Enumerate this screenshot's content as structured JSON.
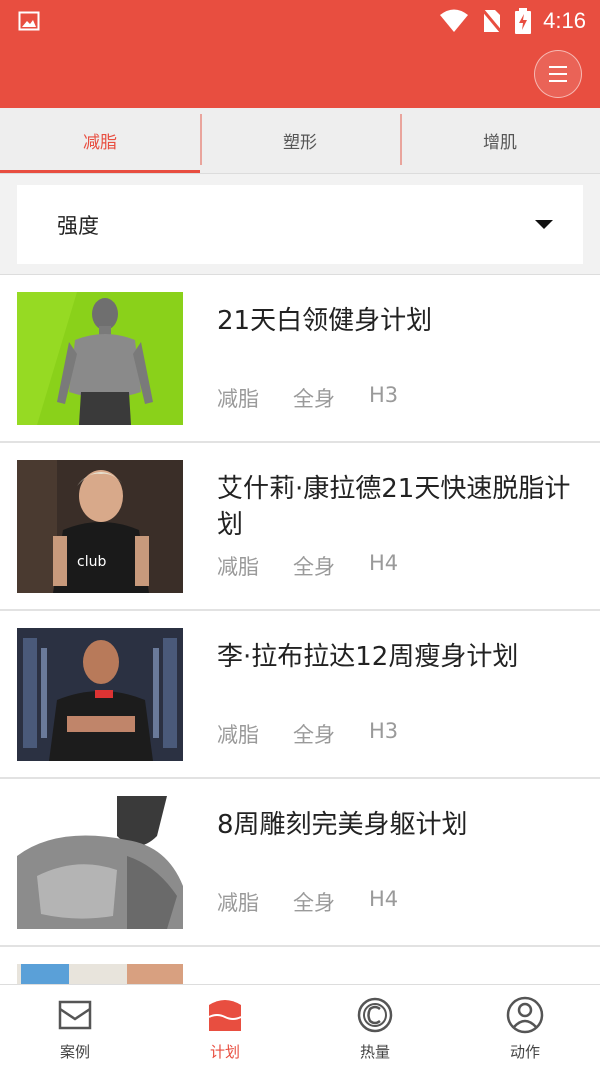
{
  "status_bar": {
    "time": "4:16",
    "icons": [
      "image-icon",
      "wifi-icon",
      "no-sim-icon",
      "battery-charging-icon"
    ]
  },
  "app_bar": {
    "menu_icon": "menu-icon"
  },
  "colors": {
    "primary": "#e84e40",
    "tag_text": "#9a9a9a",
    "background": "#f2f2f2"
  },
  "tabs": [
    {
      "label": "减脂",
      "active": true
    },
    {
      "label": "塑形",
      "active": false
    },
    {
      "label": "增肌",
      "active": false
    }
  ],
  "filter": {
    "label": "强度",
    "icon": "dropdown-caret-icon"
  },
  "plans": [
    {
      "title": "21天白领健身计划",
      "tags": [
        "减脂",
        "全身",
        "H3"
      ]
    },
    {
      "title": "艾什莉·康拉德21天快速脱脂计划",
      "tags": [
        "减脂",
        "全身",
        "H4"
      ]
    },
    {
      "title": "李·拉布拉达12周瘦身计划",
      "tags": [
        "减脂",
        "全身",
        "H3"
      ]
    },
    {
      "title": "8周雕刻完美身躯计划",
      "tags": [
        "减脂",
        "全身",
        "H4"
      ]
    },
    {
      "title": "",
      "tags": [
        "",
        "",
        ""
      ]
    }
  ],
  "bottom_nav": [
    {
      "label": "案例",
      "icon": "inbox-icon",
      "active": false
    },
    {
      "label": "计划",
      "icon": "calendar-icon",
      "active": true
    },
    {
      "label": "热量",
      "icon": "calorie-icon",
      "active": false
    },
    {
      "label": "动作",
      "icon": "user-icon",
      "active": false
    }
  ]
}
